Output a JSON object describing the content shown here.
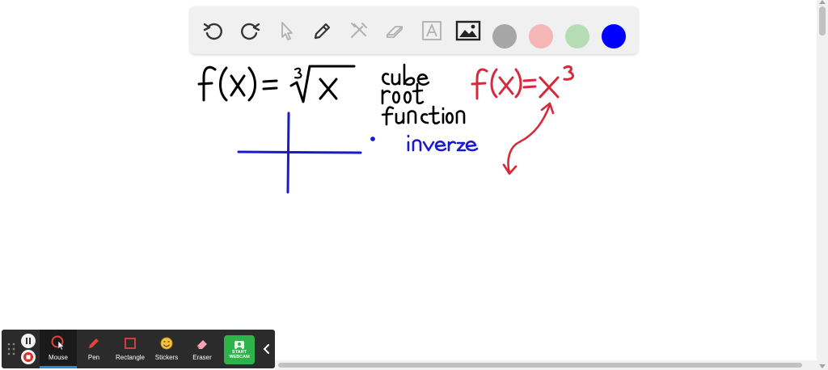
{
  "toolbar": {
    "tools": [
      {
        "name": "undo-icon"
      },
      {
        "name": "redo-icon"
      },
      {
        "name": "select-arrow-icon"
      },
      {
        "name": "pen-icon"
      },
      {
        "name": "tools-icon"
      },
      {
        "name": "eraser-icon"
      },
      {
        "name": "text-icon"
      },
      {
        "name": "image-icon"
      }
    ],
    "colors": [
      "#a6a6a6",
      "#f4b6b6",
      "#b6dcb6",
      "#0000ff"
    ]
  },
  "canvas": {
    "line1_left": "f(x) = ∛x",
    "label_cube": "cube",
    "label_root": "root",
    "label_function": "function",
    "label_inverse": "inverse",
    "line1_right": "f(x)=x³",
    "ink_colors": {
      "black": "#000000",
      "blue": "#1a1acc",
      "red": "#d42a3c"
    }
  },
  "recorder": {
    "tools": [
      {
        "label": "Mouse",
        "active": true
      },
      {
        "label": "Pen",
        "active": false
      },
      {
        "label": "Rectangle",
        "active": false
      },
      {
        "label": "Stickers",
        "active": false
      },
      {
        "label": "Eraser",
        "active": false
      }
    ],
    "webcam_line1": "START",
    "webcam_line2": "WEBCAM",
    "accent": "#1e88e5",
    "webcam_color": "#2db34a"
  }
}
